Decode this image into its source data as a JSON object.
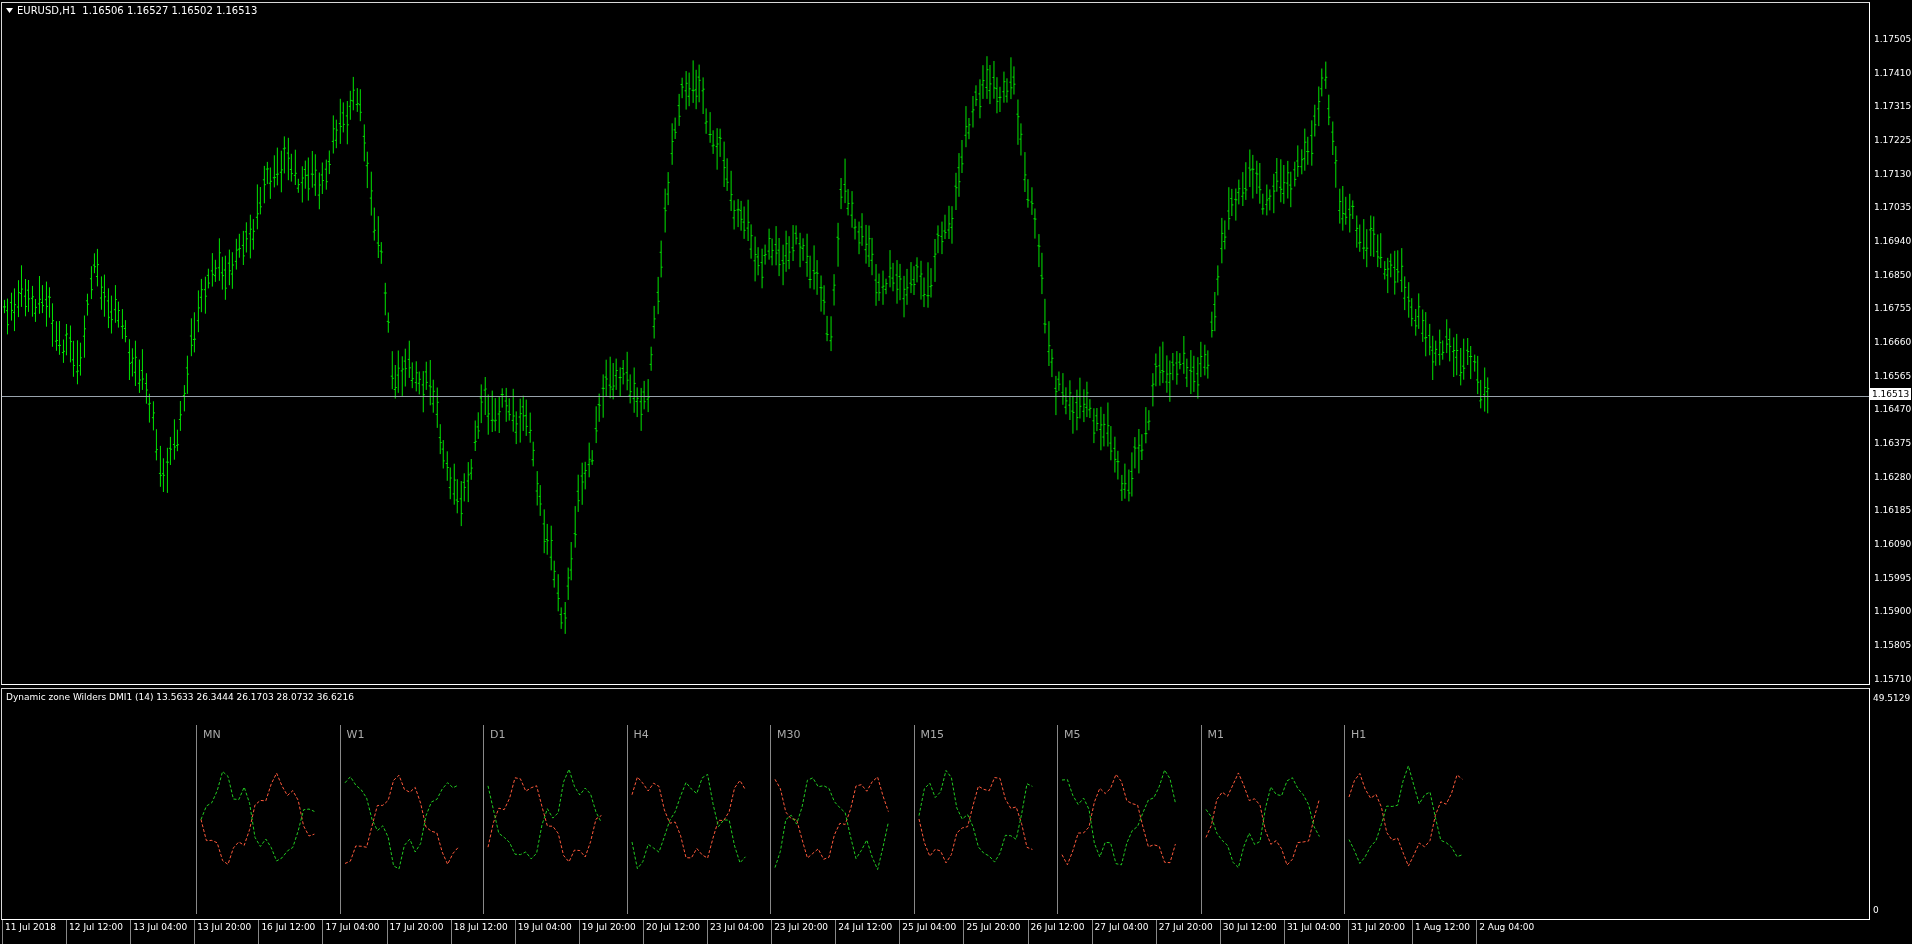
{
  "chart": {
    "header": {
      "symbol": "EURUSD,H1",
      "ohlc": "1.16506 1.16527 1.16502 1.16513"
    },
    "price_axis": [
      "1.17505",
      "1.17410",
      "1.17315",
      "1.17225",
      "1.17130",
      "1.17035",
      "1.16940",
      "1.16850",
      "1.16755",
      "1.16660",
      "1.16565",
      "1.16470",
      "1.16375",
      "1.16280",
      "1.16185",
      "1.16090",
      "1.15995",
      "1.15900",
      "1.15805",
      "1.15710"
    ],
    "current_price": "1.16513"
  },
  "indicator": {
    "title": "Dynamic zone Wilders DMI1 (14) 13.5633 26.3444 26.1703 28.0732 36.6216",
    "axis_max": "49.5129",
    "axis_min": "0",
    "panels": [
      "MN",
      "W1",
      "D1",
      "H4",
      "M30",
      "M15",
      "M5",
      "M1",
      "H1"
    ]
  },
  "time_axis": [
    "11 Jul 2018",
    "12 Jul 12:00",
    "13 Jul 04:00",
    "13 Jul 20:00",
    "16 Jul 12:00",
    "17 Jul 04:00",
    "17 Jul 20:00",
    "18 Jul 12:00",
    "19 Jul 04:00",
    "19 Jul 20:00",
    "20 Jul 12:00",
    "23 Jul 04:00",
    "23 Jul 20:00",
    "24 Jul 12:00",
    "25 Jul 04:00",
    "25 Jul 20:00",
    "26 Jul 12:00",
    "27 Jul 04:00",
    "27 Jul 20:00",
    "30 Jul 12:00",
    "31 Jul 04:00",
    "31 Jul 20:00",
    "1 Aug 12:00",
    "2 Aug 04:00"
  ]
}
